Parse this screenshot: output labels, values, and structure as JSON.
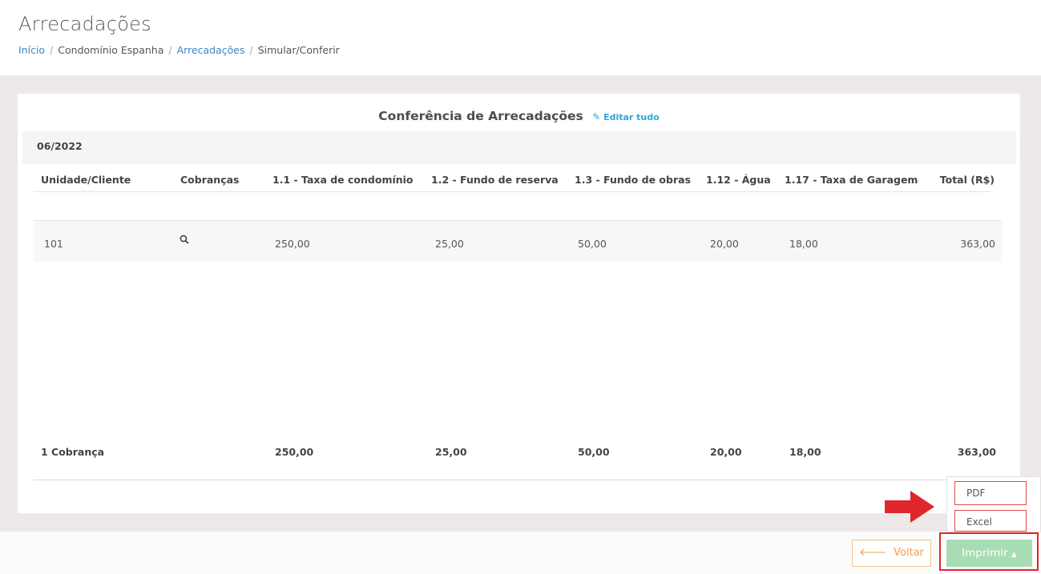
{
  "page": {
    "title": "Arrecadações",
    "breadcrumb": {
      "inicio": "Início",
      "condominio": "Condomínio Espanha",
      "arrecadacoes": "Arrecadações",
      "current": "Simular/Conferir",
      "separator": "/"
    }
  },
  "card": {
    "title": "Conferência de Arrecadações",
    "edit_label": "Editar tudo",
    "period": "06/2022"
  },
  "table": {
    "headers": [
      "Unidade/Cliente",
      "Cobranças",
      "1.1 - Taxa de condomínio",
      "1.2 - Fundo de reserva",
      "1.3 - Fundo de obras",
      "1.12 - Água",
      "1.17 - Taxa de Garagem",
      "Total (R$)"
    ],
    "rows": [
      {
        "unidade": "101",
        "cobrancas_icon": "search-icon",
        "taxa_condominio": "250,00",
        "fundo_reserva": "25,00",
        "fundo_obras": "50,00",
        "agua": "20,00",
        "taxa_garagem": "18,00",
        "total": "363,00"
      }
    ],
    "footer": {
      "label": "1 Cobrança",
      "taxa_condominio": "250,00",
      "fundo_reserva": "25,00",
      "fundo_obras": "50,00",
      "agua": "20,00",
      "taxa_garagem": "18,00",
      "total": "363,00"
    }
  },
  "actions": {
    "voltar_label": "Voltar",
    "voltar_icon": "arrow-left-icon",
    "imprimir_label": "Imprimir",
    "imprimir_icon": "caret-up-icon",
    "dropdown": {
      "pdf": "PDF",
      "excel": "Excel"
    }
  },
  "colors": {
    "link": "#3a86c6",
    "edit": "#2aa8d8",
    "imprimir_bg": "#a8dcb3",
    "voltar_border": "#f3c08a",
    "annotation_red": "#e0262a"
  }
}
